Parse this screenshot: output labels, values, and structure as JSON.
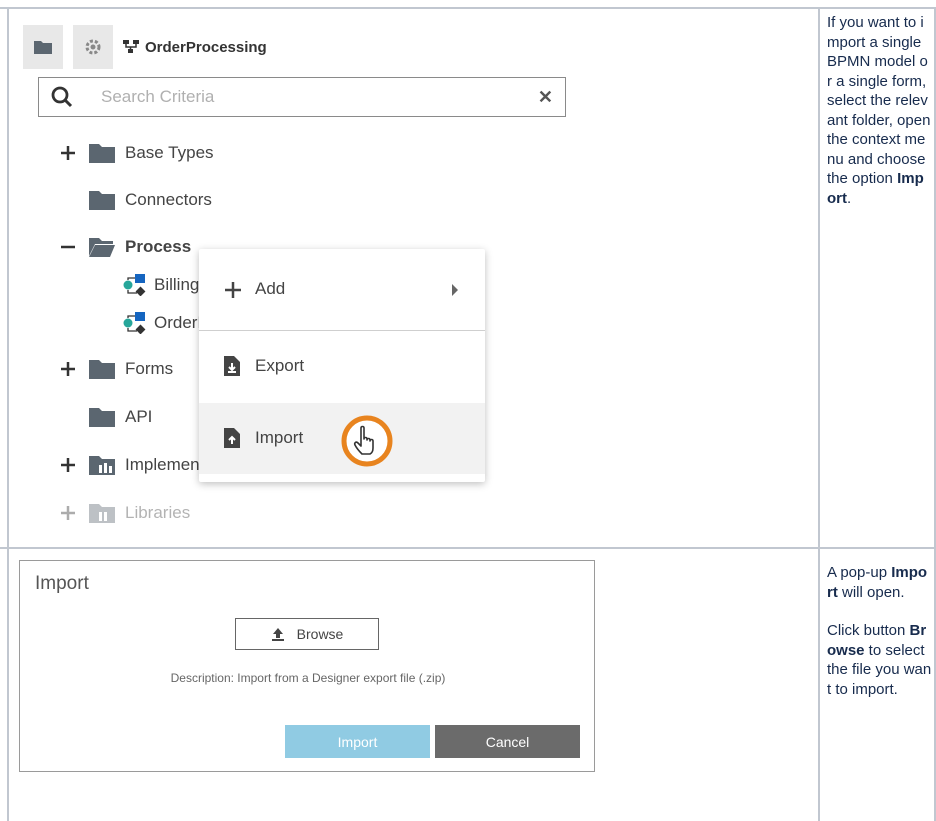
{
  "explorer": {
    "project_title": "OrderProcessing",
    "search": {
      "placeholder": "Search Criteria",
      "value": ""
    },
    "tree": [
      {
        "label": "Base Types",
        "toggle": "+"
      },
      {
        "label": "Connectors",
        "toggle": ""
      },
      {
        "label": "Process",
        "toggle": "−"
      },
      {
        "label": "Billing",
        "toggle": ""
      },
      {
        "label": "OrderProcessing",
        "toggle": ""
      },
      {
        "label": "Forms",
        "toggle": "+"
      },
      {
        "label": "API",
        "toggle": ""
      },
      {
        "label": "Implementation",
        "toggle": "+"
      },
      {
        "label": "Libraries",
        "toggle": "+"
      }
    ],
    "context_menu": {
      "add_label": "Add",
      "export_label": "Export",
      "import_label": "Import"
    }
  },
  "dialog": {
    "title": "Import",
    "browse_label": "Browse",
    "description": "Description: Import from a Designer export file (.zip)",
    "import_label": "Import",
    "cancel_label": "Cancel"
  },
  "instructions": {
    "row1_text": "If you want to import a single BPMN model or a single form, select the relevant folder, open the context menu and choose the option ",
    "row1_bold": "Import",
    "row1_end": ".",
    "row2_p1_text": "A pop-up ",
    "row2_p1_bold": "Import",
    "row2_p1_end": " will open.",
    "row2_p2_text": "Click button ",
    "row2_p2_bold": "Browse",
    "row2_p2_end": " to select the file you want to import."
  },
  "colors": {
    "accent_orange": "#e8841f",
    "import_blue": "#90cbe3",
    "cancel_gray": "#6b6b6b",
    "table_border": "#c1c7d0"
  }
}
